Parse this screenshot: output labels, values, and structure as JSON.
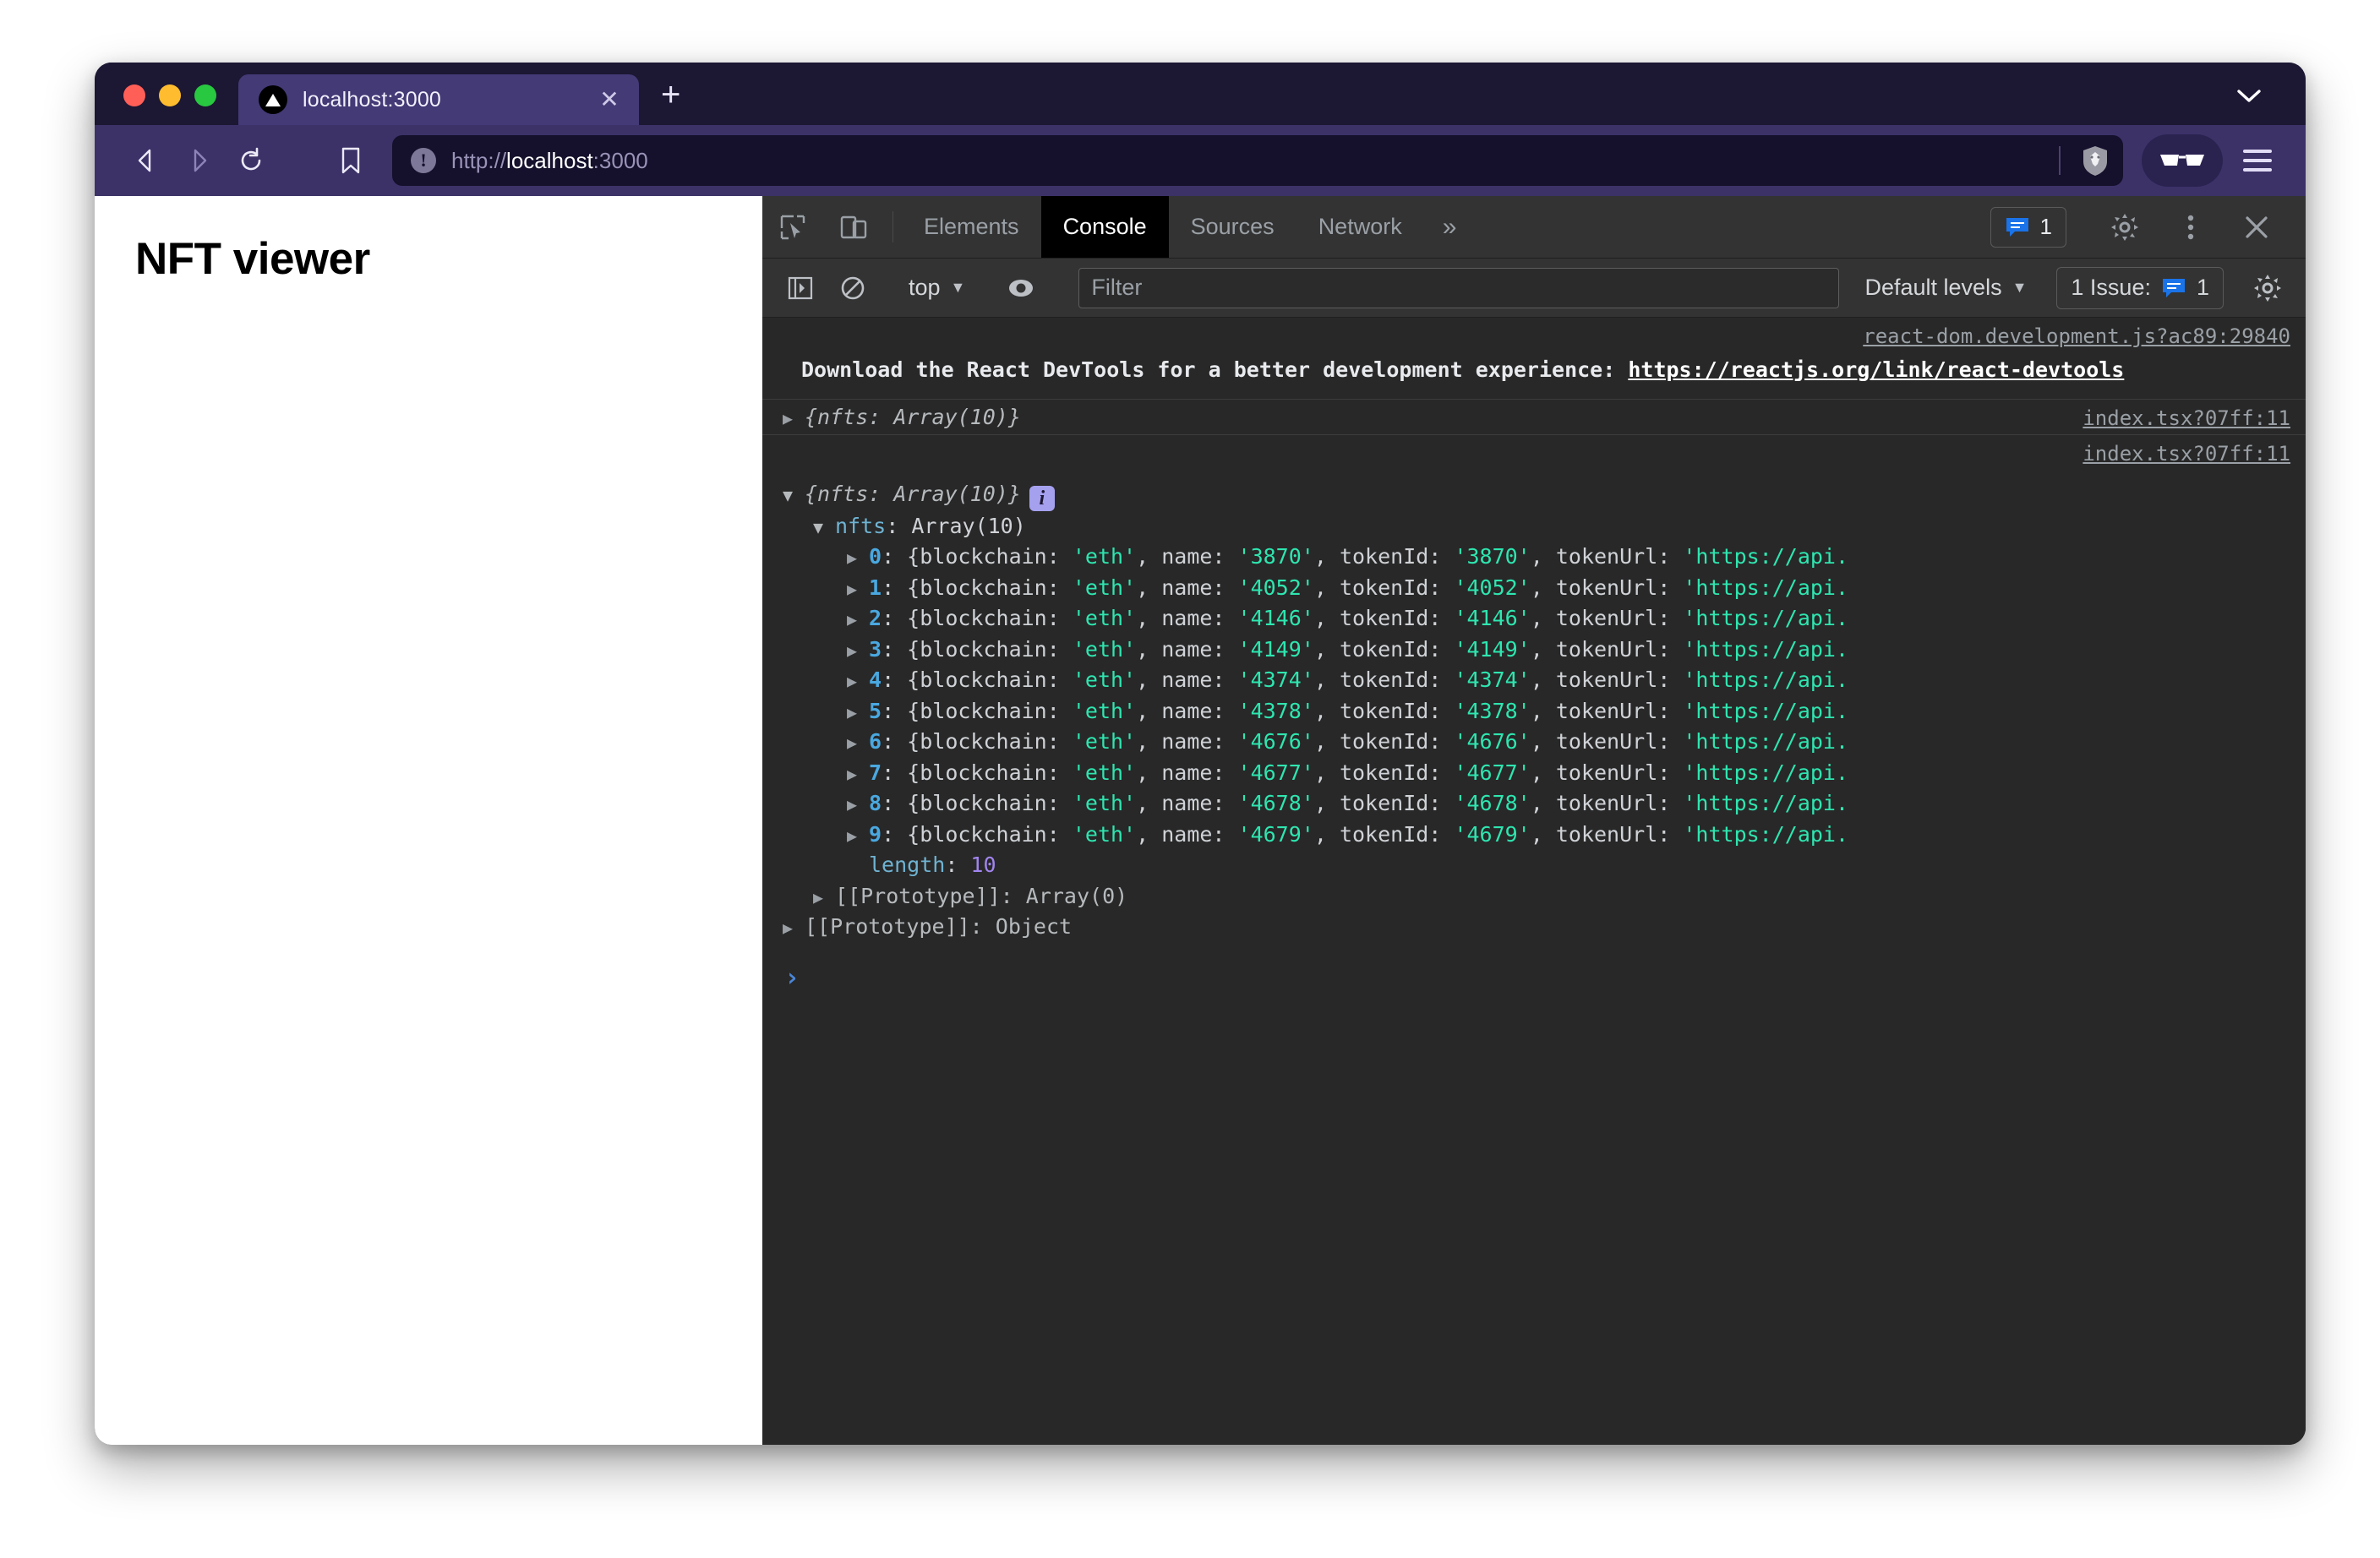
{
  "browser": {
    "tab": {
      "title": "localhost:3000",
      "favicon": "nextjs-triangle-icon",
      "close": "✕"
    },
    "newtab_label": "+",
    "tabsearch_icon": "chevron-down-icon",
    "nav": {
      "back": "back-icon",
      "forward": "forward-icon",
      "reload": "reload-icon",
      "bookmark": "bookmark-icon"
    },
    "url": {
      "scheme": "http://",
      "host": "localhost",
      "port": ":3000",
      "full": "http://localhost:3000"
    },
    "shield_icon": "brave-shield-lion-icon",
    "extension_icon": "glasses-icon",
    "menu_icon": "hamburger-menu-icon"
  },
  "page": {
    "title": "NFT viewer"
  },
  "devtools": {
    "inspect_icon": "inspect-element-icon",
    "device_icon": "device-toolbar-icon",
    "tabs": [
      {
        "label": "Elements",
        "active": false
      },
      {
        "label": "Console",
        "active": true
      },
      {
        "label": "Sources",
        "active": false
      },
      {
        "label": "Network",
        "active": false
      }
    ],
    "more_tabs": "»",
    "issue_count": "1",
    "settings_icon": "gear-icon",
    "kebab_icon": "more-options-icon",
    "close_icon": "close-icon",
    "toolbar": {
      "sidebar_icon": "console-sidebar-icon",
      "clear_icon": "clear-console-icon",
      "context": "top",
      "eye_icon": "live-expression-eye-icon",
      "filter_placeholder": "Filter",
      "filter_value": "",
      "levels": "Default levels",
      "issues_label": "1 Issue:",
      "issues_count": "1",
      "settings_icon": "console-settings-gear-icon"
    },
    "messages": {
      "react_src": "react-dom.development.js?ac89:29840",
      "react_text": "Download the React DevTools for a better development experience: ",
      "react_link": "https://reactjs.org/link/react-devtools",
      "log1_src": "index.tsx?07ff:11",
      "log1_preview": "{nfts: Array(10)}",
      "log2_src": "index.tsx?07ff:11",
      "log2_preview": "{nfts: Array(10)}",
      "nfts_key": "nfts",
      "nfts_value": "Array(10)",
      "length_key": "length",
      "length_value": "10",
      "proto_inner": "[[Prototype]]: Array(0)",
      "proto_outer": "[[Prototype]]: Object",
      "prompt": "›"
    },
    "nfts": [
      {
        "index": "0",
        "blockchain": "eth",
        "name": "3870",
        "tokenId": "3870",
        "tokenUrl": "https://api."
      },
      {
        "index": "1",
        "blockchain": "eth",
        "name": "4052",
        "tokenId": "4052",
        "tokenUrl": "https://api."
      },
      {
        "index": "2",
        "blockchain": "eth",
        "name": "4146",
        "tokenId": "4146",
        "tokenUrl": "https://api."
      },
      {
        "index": "3",
        "blockchain": "eth",
        "name": "4149",
        "tokenId": "4149",
        "tokenUrl": "https://api."
      },
      {
        "index": "4",
        "blockchain": "eth",
        "name": "4374",
        "tokenId": "4374",
        "tokenUrl": "https://api."
      },
      {
        "index": "5",
        "blockchain": "eth",
        "name": "4378",
        "tokenId": "4378",
        "tokenUrl": "https://api."
      },
      {
        "index": "6",
        "blockchain": "eth",
        "name": "4676",
        "tokenId": "4676",
        "tokenUrl": "https://api."
      },
      {
        "index": "7",
        "blockchain": "eth",
        "name": "4677",
        "tokenId": "4677",
        "tokenUrl": "https://api."
      },
      {
        "index": "8",
        "blockchain": "eth",
        "name": "4678",
        "tokenId": "4678",
        "tokenUrl": "https://api."
      },
      {
        "index": "9",
        "blockchain": "eth",
        "name": "4679",
        "tokenId": "4679",
        "tokenUrl": "https://api."
      }
    ],
    "labels": {
      "obj_open": "{",
      "blockchain_key": "blockchain: ",
      "name_key": ", name: ",
      "tokenid_key": ", tokenId: ",
      "tokenurl_key": ", tokenUrl: ",
      "quote": "'"
    }
  },
  "colors": {
    "browser_chrome": "#3c3268",
    "tab_active": "#433a76",
    "devtools_bg": "#282828",
    "string_green": "#2ee6b0",
    "number_purple": "#a285f0",
    "key_blue": "#6fb3d2",
    "accent_blue": "#4a86d8"
  }
}
